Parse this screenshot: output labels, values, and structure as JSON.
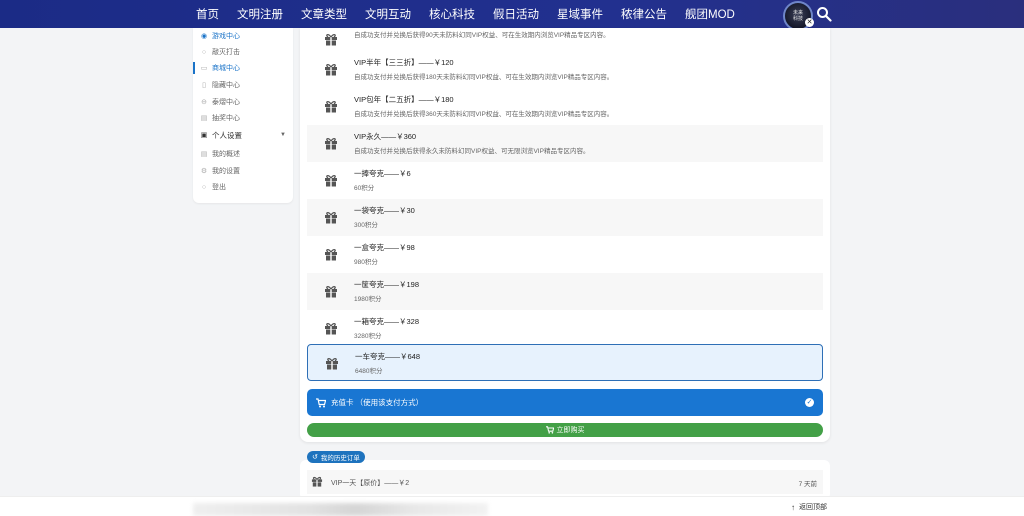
{
  "nav": {
    "items": [
      "首页",
      "文明注册",
      "文章类型",
      "文明互动",
      "核心科技",
      "假日活动",
      "星域事件",
      "秾律公告",
      "舰团MOD"
    ],
    "avatar_text": "未来\n科技"
  },
  "sidebar": {
    "items": [
      {
        "label": "游戏中心",
        "icon": "gamepad-icon",
        "style": "blue"
      },
      {
        "label": "敲灭打击",
        "icon": "circle-icon",
        "style": ""
      },
      {
        "label": "商城中心",
        "icon": "store-icon",
        "style": "active"
      },
      {
        "label": "隐藏中心",
        "icon": "file-icon",
        "style": ""
      },
      {
        "label": "泰熠中心",
        "icon": "clock-icon",
        "style": ""
      },
      {
        "label": "抽奖中心",
        "icon": "gift-icon",
        "style": ""
      },
      {
        "label": "个人设置",
        "icon": "id-card-icon",
        "style": "header"
      },
      {
        "label": "我的概述",
        "icon": "list-icon",
        "style": ""
      },
      {
        "label": "我的设置",
        "icon": "gear-icon",
        "style": ""
      },
      {
        "label": "登出",
        "icon": "logout-icon",
        "style": ""
      }
    ]
  },
  "products": [
    {
      "title": "",
      "desc": "自成功支付并兑换后获得90天未防料幻同VIP权益、可在生效期内浏览VIP精品专区内容。"
    },
    {
      "title": "VIP半年【三三折】——￥120",
      "desc": "自成功支付并兑换后获得180天未防料幻同VIP权益、可在生效期内浏览VIP精品专区内容。"
    },
    {
      "title": "VIP包年【二五折】——￥180",
      "desc": "自成功支付并兑换后获得360天未防料幻同VIP权益、可在生效期内浏览VIP精品专区内容。"
    },
    {
      "title": "VIP永久——￥360",
      "desc": "自成功支付并兑换后获得永久未防料幻同VIP权益、可无限浏览VIP精品专区内容。"
    },
    {
      "title": "一捧夸克——￥6",
      "desc": "60积分"
    },
    {
      "title": "一袋夸克——￥30",
      "desc": "300积分"
    },
    {
      "title": "一盒夸克——￥98",
      "desc": "980积分"
    },
    {
      "title": "一筐夸克——￥198",
      "desc": "1980积分"
    },
    {
      "title": "一箱夸克——￥328",
      "desc": "3280积分"
    },
    {
      "title": "一车夸克——￥648",
      "desc": "6480积分"
    }
  ],
  "payment": {
    "method_label": "充值卡 （使用该支付方式）",
    "buy_label": "立即购买"
  },
  "history": {
    "tag_label": "我的历史订单",
    "row_title": "VIP一天【原价】——￥2",
    "row_time": "7 天前"
  },
  "footer": {
    "back_to_top": "返回顶部"
  },
  "colors": {
    "nav_bg": "#1f2d8a",
    "accent": "#1976d2",
    "buy": "#43a047",
    "selected_border": "#2e6fb6"
  }
}
